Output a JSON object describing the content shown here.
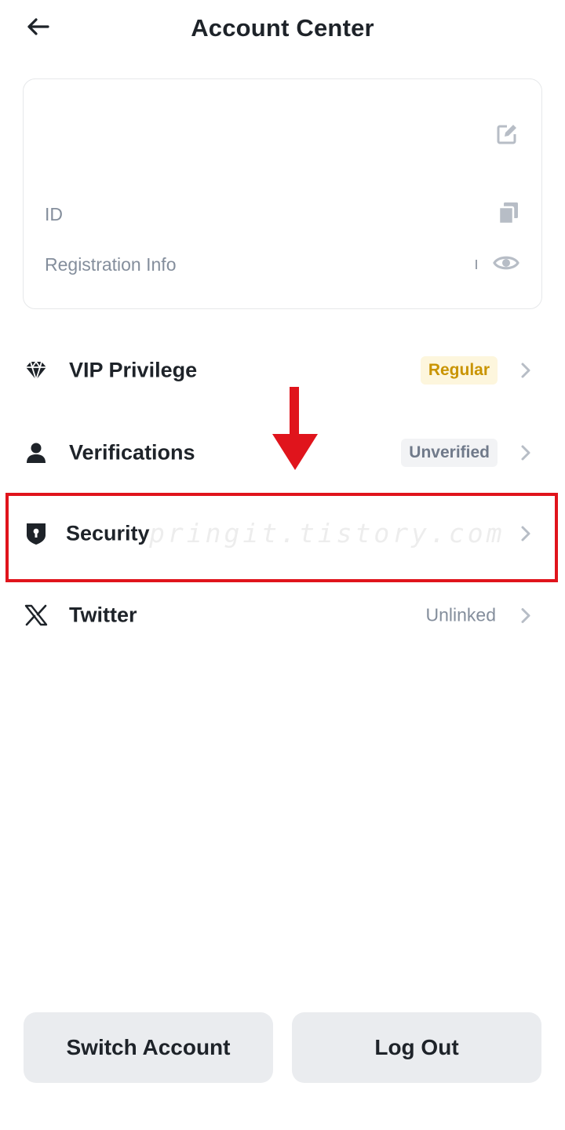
{
  "header": {
    "title": "Account Center",
    "back_icon": "arrow-left-icon"
  },
  "account_card": {
    "edit_icon": "edit-icon",
    "id_label": "ID",
    "copy_icon": "copy-icon",
    "registration_label": "Registration Info",
    "visibility_icon": "eye-icon"
  },
  "menu": {
    "items": [
      {
        "label": "VIP Privilege",
        "icon": "diamond-icon",
        "status": "Regular"
      },
      {
        "label": "Verifications",
        "icon": "person-icon",
        "status": "Unverified"
      },
      {
        "label": "Security",
        "icon": "shield-lock-icon",
        "status": ""
      },
      {
        "label": "Twitter",
        "icon": "x-logo-icon",
        "status": "Unlinked"
      }
    ],
    "chevron_icon": "chevron-right-icon"
  },
  "annotation": {
    "highlighted_item": "Security",
    "arrow_color": "#e0141c",
    "box_color": "#e0141c",
    "watermark": "pringit.tistory.com"
  },
  "footer": {
    "switch_account_label": "Switch Account",
    "log_out_label": "Log Out"
  },
  "colors": {
    "text_primary": "#1e2329",
    "text_secondary": "#848e9c",
    "badge_regular_bg": "#fdf6dd",
    "badge_regular_text": "#c99400",
    "badge_unverified_bg": "#f2f3f5",
    "button_bg": "#eaecef"
  }
}
